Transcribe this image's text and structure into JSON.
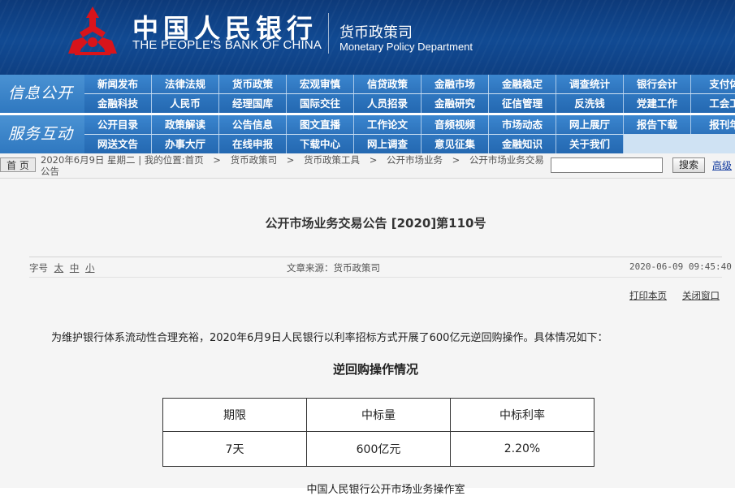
{
  "header": {
    "bank_name_cn": "中国人民银行",
    "bank_name_en": "THE PEOPLE'S BANK OF CHINA",
    "dept_cn": "货币政策司",
    "dept_en": "Monetary Policy Department",
    "brand_color": "#0d3a7a",
    "emblem_color": "#d8141b"
  },
  "nav": {
    "section1_label": "信息公开",
    "section2_label": "服务互动",
    "row1": [
      "新闻发布",
      "法律法规",
      "货币政策",
      "宏观审慎",
      "信贷政策",
      "金融市场",
      "金融稳定",
      "调查统计",
      "银行会计",
      "支付体"
    ],
    "row2": [
      "金融科技",
      "人民币",
      "经理国库",
      "国际交往",
      "人员招录",
      "金融研究",
      "征信管理",
      "反洗钱",
      "党建工作",
      "工会工"
    ],
    "row3": [
      "公开目录",
      "政策解读",
      "公告信息",
      "图文直播",
      "工作论文",
      "音频视频",
      "市场动态",
      "网上展厅",
      "报告下载",
      "报刊年"
    ],
    "row4": [
      "网送文告",
      "办事大厅",
      "在线申报",
      "下载中心",
      "网上调查",
      "意见征集",
      "金融知识",
      "关于我们"
    ]
  },
  "breadcrumb": {
    "home": "首 页",
    "date": "2020年6月9日 星期二",
    "location_label": "我的位置:首页",
    "items": [
      "货币政策司",
      "货币政策工具",
      "公开市场业务",
      "公开市场业务交易公告"
    ],
    "separator": ">",
    "search_button": "搜索",
    "advanced": "高级"
  },
  "article": {
    "title": "公开市场业务交易公告 [2020]第110号",
    "font_size_label": "字号",
    "font_sizes": [
      "太",
      "中",
      "小"
    ],
    "source": "文章来源：货币政策司",
    "datetime": "2020-06-09 09:45:40",
    "print": "打印本页",
    "close": "关闭窗口",
    "paragraph": "为维护银行体系流动性合理充裕，2020年6月9日人民银行以利率招标方式开展了600亿元逆回购操作。具体情况如下：",
    "table_title": "逆回购操作情况",
    "table": {
      "headers": [
        "期限",
        "中标量",
        "中标利率"
      ],
      "rows": [
        [
          "7天",
          "600亿元",
          "2.20%"
        ]
      ]
    },
    "signature": "中国人民银行公开市场业务操作室"
  }
}
